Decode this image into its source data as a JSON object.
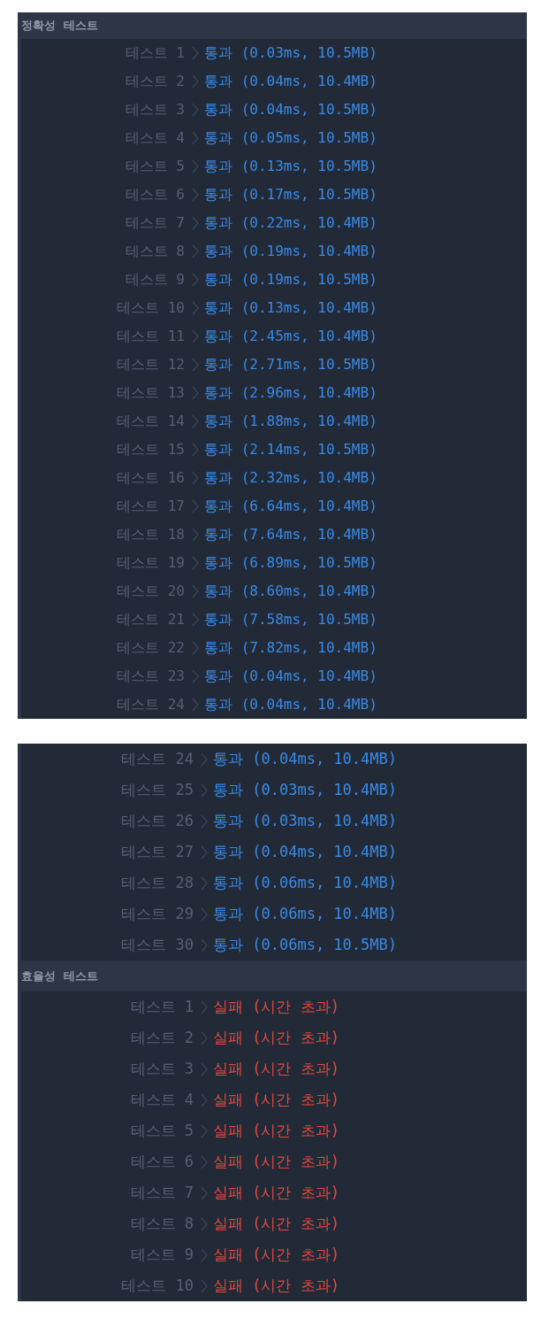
{
  "panels": [
    {
      "groups": [
        {
          "heading": "정확성  테스트",
          "rows": [
            {
              "label": "테스트 1",
              "kind": "pass",
              "result": "통과 (0.03ms, 10.5MB)"
            },
            {
              "label": "테스트 2",
              "kind": "pass",
              "result": "통과 (0.04ms, 10.4MB)"
            },
            {
              "label": "테스트 3",
              "kind": "pass",
              "result": "통과 (0.04ms, 10.5MB)"
            },
            {
              "label": "테스트 4",
              "kind": "pass",
              "result": "통과 (0.05ms, 10.5MB)"
            },
            {
              "label": "테스트 5",
              "kind": "pass",
              "result": "통과 (0.13ms, 10.5MB)"
            },
            {
              "label": "테스트 6",
              "kind": "pass",
              "result": "통과 (0.17ms, 10.5MB)"
            },
            {
              "label": "테스트 7",
              "kind": "pass",
              "result": "통과 (0.22ms, 10.4MB)"
            },
            {
              "label": "테스트 8",
              "kind": "pass",
              "result": "통과 (0.19ms, 10.4MB)"
            },
            {
              "label": "테스트 9",
              "kind": "pass",
              "result": "통과 (0.19ms, 10.5MB)"
            },
            {
              "label": "테스트 10",
              "kind": "pass",
              "result": "통과 (0.13ms, 10.4MB)"
            },
            {
              "label": "테스트 11",
              "kind": "pass",
              "result": "통과 (2.45ms, 10.4MB)"
            },
            {
              "label": "테스트 12",
              "kind": "pass",
              "result": "통과 (2.71ms, 10.5MB)"
            },
            {
              "label": "테스트 13",
              "kind": "pass",
              "result": "통과 (2.96ms, 10.4MB)"
            },
            {
              "label": "테스트 14",
              "kind": "pass",
              "result": "통과 (1.88ms, 10.4MB)"
            },
            {
              "label": "테스트 15",
              "kind": "pass",
              "result": "통과 (2.14ms, 10.5MB)"
            },
            {
              "label": "테스트 16",
              "kind": "pass",
              "result": "통과 (2.32ms, 10.4MB)"
            },
            {
              "label": "테스트 17",
              "kind": "pass",
              "result": "통과 (6.64ms, 10.4MB)"
            },
            {
              "label": "테스트 18",
              "kind": "pass",
              "result": "통과 (7.64ms, 10.4MB)"
            },
            {
              "label": "테스트 19",
              "kind": "pass",
              "result": "통과 (6.89ms, 10.5MB)"
            },
            {
              "label": "테스트 20",
              "kind": "pass",
              "result": "통과 (8.60ms, 10.4MB)"
            },
            {
              "label": "테스트 21",
              "kind": "pass",
              "result": "통과 (7.58ms, 10.5MB)"
            },
            {
              "label": "테스트 22",
              "kind": "pass",
              "result": "통과 (7.82ms, 10.4MB)"
            },
            {
              "label": "테스트 23",
              "kind": "pass",
              "result": "통과 (0.04ms, 10.4MB)"
            },
            {
              "label": "테스트 24",
              "kind": "pass",
              "result": "통과 (0.04ms, 10.4MB)"
            }
          ]
        }
      ]
    },
    {
      "groups": [
        {
          "rows": [
            {
              "label": "테스트 24",
              "kind": "pass",
              "result": "통과 (0.04ms, 10.4MB)"
            },
            {
              "label": "테스트 25",
              "kind": "pass",
              "result": "통과 (0.03ms, 10.4MB)"
            },
            {
              "label": "테스트 26",
              "kind": "pass",
              "result": "통과 (0.03ms, 10.4MB)"
            },
            {
              "label": "테스트 27",
              "kind": "pass",
              "result": "통과 (0.04ms, 10.4MB)"
            },
            {
              "label": "테스트 28",
              "kind": "pass",
              "result": "통과 (0.06ms, 10.4MB)"
            },
            {
              "label": "테스트 29",
              "kind": "pass",
              "result": "통과 (0.06ms, 10.4MB)"
            },
            {
              "label": "테스트 30",
              "kind": "pass",
              "result": "통과 (0.06ms, 10.5MB)"
            }
          ]
        },
        {
          "heading": "효율성  테스트",
          "rows": [
            {
              "label": "테스트 1",
              "kind": "fail",
              "result": "실패 (시간 초과)"
            },
            {
              "label": "테스트 2",
              "kind": "fail",
              "result": "실패 (시간 초과)"
            },
            {
              "label": "테스트 3",
              "kind": "fail",
              "result": "실패 (시간 초과)"
            },
            {
              "label": "테스트 4",
              "kind": "fail",
              "result": "실패 (시간 초과)"
            },
            {
              "label": "테스트 5",
              "kind": "fail",
              "result": "실패 (시간 초과)"
            },
            {
              "label": "테스트 6",
              "kind": "fail",
              "result": "실패 (시간 초과)"
            },
            {
              "label": "테스트 7",
              "kind": "fail",
              "result": "실패 (시간 초과)"
            },
            {
              "label": "테스트 8",
              "kind": "fail",
              "result": "실패 (시간 초과)"
            },
            {
              "label": "테스트 9",
              "kind": "fail",
              "result": "실패 (시간 초과)"
            },
            {
              "label": "테스트 10",
              "kind": "fail",
              "result": "실패 (시간 초과)"
            }
          ]
        }
      ]
    }
  ]
}
